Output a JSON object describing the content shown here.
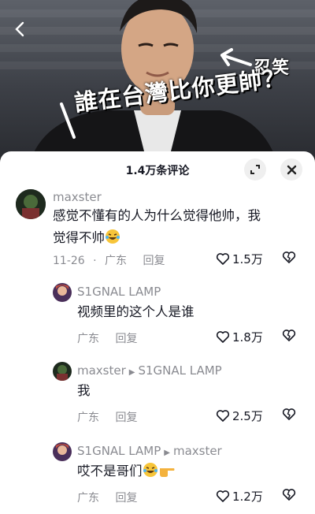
{
  "video": {
    "caption_top": "忍笑",
    "caption_main": "誰在台灣比你更帥？"
  },
  "panel": {
    "title": "1.4万条评论"
  },
  "comments": [
    {
      "author": "maxster",
      "text_line1": "感觉不懂有的人为什么觉得他帅，我",
      "text_line2": "觉得不帅",
      "date": "11-26",
      "sep": "·",
      "location": "广东",
      "reply_label": "回复",
      "likes": "1.5万"
    },
    {
      "author": "S1GNAL LAMP",
      "text": "视频里的这个人是谁",
      "location": "广东",
      "reply_label": "回复",
      "likes": "1.8万"
    },
    {
      "author": "maxster",
      "reply_to": "S1GNAL LAMP",
      "text": "我",
      "location": "广东",
      "reply_label": "回复",
      "likes": "2.5万"
    },
    {
      "author": "S1GNAL LAMP",
      "reply_to": "maxster",
      "text": "哎不是哥们",
      "location": "广东",
      "reply_label": "回复",
      "likes": "1.2万"
    }
  ],
  "icons": {
    "back": "chevron-left-icon",
    "expand": "expand-icon",
    "close": "close-icon",
    "like": "heart-outline-icon",
    "dislike": "broken-heart-icon",
    "emoji_laugh": "laughing-crying-emoji",
    "emoji_point": "pointing-hand-emoji"
  },
  "colors": {
    "text_primary": "#161823",
    "text_secondary": "#8a8b91",
    "panel_bg": "#ffffff"
  }
}
